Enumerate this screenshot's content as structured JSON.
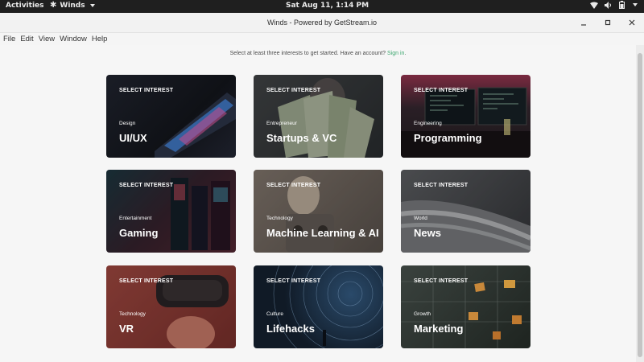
{
  "topbar": {
    "activities": "Activities",
    "app_name": "Winds",
    "clock": "Sat Aug 11,  1:14 PM"
  },
  "window": {
    "title": "Winds - Powered by GetStream.io"
  },
  "menu": [
    "File",
    "Edit",
    "View",
    "Window",
    "Help"
  ],
  "prompt": {
    "text": "Select at least three interests to get started. Have an account? ",
    "link": "Sign in",
    "end": "."
  },
  "cards": [
    {
      "select": "SELECT INTEREST",
      "category": "Design",
      "name": "UI/UX",
      "color": "#151820",
      "accent": "#3a78c8"
    },
    {
      "select": "SELECT INTEREST",
      "category": "Entrepreneur",
      "name": "Startups & VC",
      "color": "#3b3f40",
      "accent": "#b7c9a8"
    },
    {
      "select": "SELECT INTEREST",
      "category": "Engineering",
      "name": "Programming",
      "color": "#2a1f26",
      "accent": "#9e3a52"
    },
    {
      "select": "SELECT INTEREST",
      "category": "Entertainment",
      "name": "Gaming",
      "color": "#3a2430",
      "accent": "#b34a5a"
    },
    {
      "select": "SELECT INTEREST",
      "category": "Technology",
      "name": "Machine Learning & AI",
      "color": "#6b6460",
      "accent": "#c8a888"
    },
    {
      "select": "SELECT INTEREST",
      "category": "World",
      "name": "News",
      "color": "#45484c",
      "accent": "#c5c7ca"
    },
    {
      "select": "SELECT INTEREST",
      "category": "Technology",
      "name": "VR",
      "color": "#8a3a36",
      "accent": "#c45a4c"
    },
    {
      "select": "SELECT INTEREST",
      "category": "Culture",
      "name": "Lifehacks",
      "color": "#101a26",
      "accent": "#4a6a8a"
    },
    {
      "select": "SELECT INTEREST",
      "category": "Growth",
      "name": "Marketing",
      "color": "#2c3430",
      "accent": "#c8883a"
    }
  ]
}
